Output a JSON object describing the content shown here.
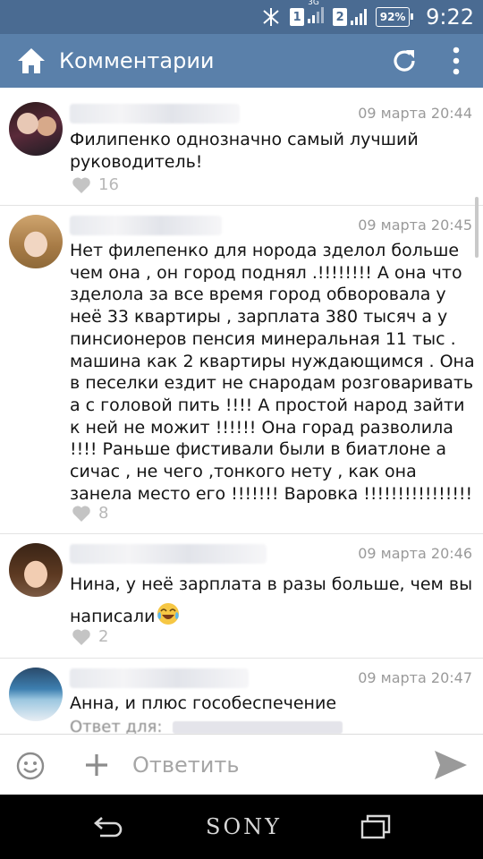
{
  "status_bar": {
    "time": "9:22",
    "battery": "92%",
    "sim1": "1",
    "sim2": "2",
    "network": "3G"
  },
  "app_bar": {
    "title": "Комментарии",
    "icons": [
      "home-icon",
      "refresh-icon",
      "more-vert-icon"
    ]
  },
  "comments": [
    {
      "date": "09 марта 20:44",
      "text": "Филипенко однозначно самый лучший руководитель!",
      "likes": "16"
    },
    {
      "date": "09 марта 20:45",
      "text": "Нет филепенко для норода зделол больше чем она , он город поднял .!!!!!!!! А она что зделола за все время город обворовала у неё 33 квартиры , зарплата 380 тысяч а у пинсионеров пенсия  минеральная 11  тыс . машина как 2 квартиры нуждающимся . Она в песелки ездит  не снародам розговаривать а с головой пить !!!! А простой народ зайти к ней не можит !!!!!!  Она горад разволила !!!! Раньше фистивали были в биатлоне а сичас , не чего ,тонкого нету , как она занела место его !!!!!!! Варовка !!!!!!!!!!!!!!!!",
      "likes": "8"
    },
    {
      "date": "09 марта 20:46",
      "text": "Нина, у неё зарплата в разы больше, чем вы написали",
      "emoji": "😂",
      "likes": "2"
    },
    {
      "date": "09 марта 20:47",
      "text": "Анна, и плюс гособеспечение",
      "reply_prefix": "Ответ для:"
    }
  ],
  "input_bar": {
    "placeholder": "Ответить"
  },
  "nav_bar": {
    "brand": "SONY"
  },
  "colors": {
    "status_bar": "#4a6b92",
    "app_bar": "#5a80aa",
    "like_gray": "#b8b8b8"
  }
}
